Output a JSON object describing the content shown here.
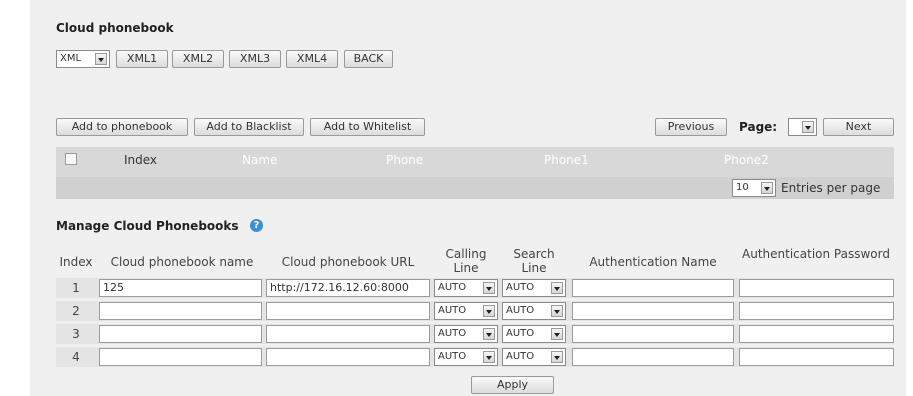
{
  "cloud_phonebook": {
    "title": "Cloud phonebook",
    "type_select": "XML",
    "buttons": [
      "XML1",
      "XML2",
      "XML3",
      "XML4",
      "BACK"
    ]
  },
  "actions": {
    "add_phonebook": "Add to phonebook",
    "add_blacklist": "Add to Blacklist",
    "add_whitelist": "Add to Whitelist",
    "previous": "Previous",
    "page_label": "Page:",
    "next": "Next"
  },
  "grid": {
    "columns": [
      "Index",
      "Name",
      "Phone",
      "Phone1",
      "Phone2"
    ],
    "entries_value": "10",
    "entries_label": "Entries per page"
  },
  "manage": {
    "title": "Manage Cloud Phonebooks",
    "headers": {
      "index": "Index",
      "name": "Cloud phonebook name",
      "url": "Cloud phonebook URL",
      "calling": "Calling Line",
      "search": "Search Line",
      "auth_name": "Authentication Name",
      "auth_pass": "Authentication Password"
    },
    "rows": [
      {
        "index": "1",
        "name": "125",
        "url": "http://172.16.12.60:8000",
        "calling": "AUTO",
        "search": "AUTO"
      },
      {
        "index": "2",
        "name": "",
        "url": "",
        "calling": "AUTO",
        "search": "AUTO"
      },
      {
        "index": "3",
        "name": "",
        "url": "",
        "calling": "AUTO",
        "search": "AUTO"
      },
      {
        "index": "4",
        "name": "",
        "url": "",
        "calling": "AUTO",
        "search": "AUTO"
      }
    ],
    "apply": "Apply"
  }
}
